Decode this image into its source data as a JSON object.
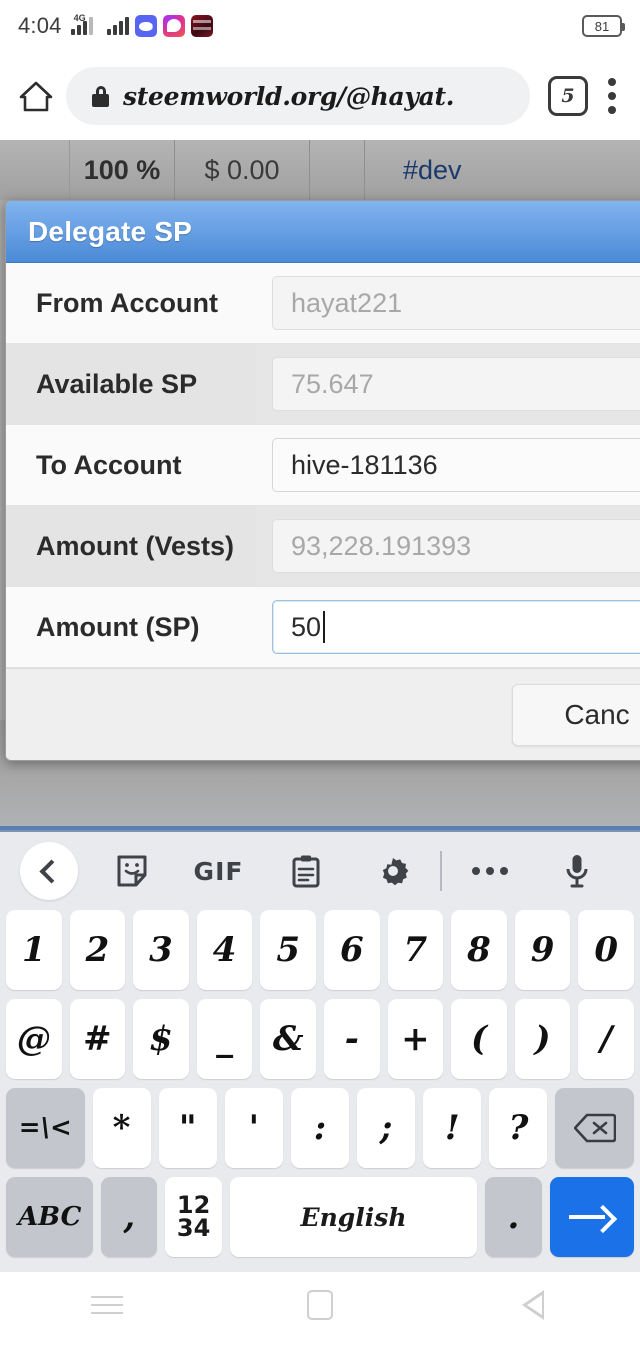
{
  "status_bar": {
    "time": "4:04",
    "network_type": "4G",
    "battery_level": "81",
    "app_icons": [
      "discord-icon",
      "messenger-icon",
      "red-app-icon"
    ]
  },
  "browser": {
    "home_icon": "home-icon",
    "lock_icon": "lock-icon",
    "url": "steemworld.org/@hayat.",
    "tab_count": "5",
    "menu_icon": "kebab-menu-icon"
  },
  "page_background": {
    "cells": [
      "",
      "100 %",
      "$ 0.00",
      "",
      "#dev"
    ],
    "ghost_text": ""
  },
  "dialog": {
    "title": "Delegate SP",
    "rows": [
      {
        "label": "From Account",
        "value": "hayat221",
        "state": "disabled"
      },
      {
        "label": "Available SP",
        "value": "75.647",
        "state": "disabled"
      },
      {
        "label": "To Account",
        "value": "hive-181136",
        "state": "enabled"
      },
      {
        "label": "Amount (Vests)",
        "value": "93,228.191393",
        "state": "disabled"
      },
      {
        "label": "Amount (SP)",
        "value": "50",
        "state": "focused"
      }
    ],
    "cancel_label": "Canc"
  },
  "keyboard": {
    "toolbar": [
      "back-chevron-icon",
      "sticker-icon",
      "GIF",
      "clipboard-icon",
      "gear-icon",
      "divider",
      "overflow-dots-icon",
      "microphone-icon"
    ],
    "gif_label": "GIF",
    "row1": [
      "1",
      "2",
      "3",
      "4",
      "5",
      "6",
      "7",
      "8",
      "9",
      "0"
    ],
    "row2": [
      "@",
      "#",
      "$",
      "_",
      "&",
      "-",
      "+",
      "(",
      ")",
      "/"
    ],
    "row3": [
      "=\\<",
      "*",
      "\"",
      "'",
      ":",
      ";",
      "!",
      "?",
      "backspace-icon"
    ],
    "row4": {
      "abc": "ABC",
      "comma": ",",
      "numbers": [
        "12",
        "34"
      ],
      "space": "English",
      "period": ".",
      "enter": "enter-arrow-icon"
    }
  },
  "nav_bar": {
    "recents": "recents-icon",
    "home": "home-square-icon",
    "back": "back-triangle-icon"
  },
  "colors": {
    "dialog_header_top": "#81b4ef",
    "dialog_header_bottom": "#4b8ad7",
    "enter_key": "#1b72e8",
    "link": "#1b3a6b"
  }
}
